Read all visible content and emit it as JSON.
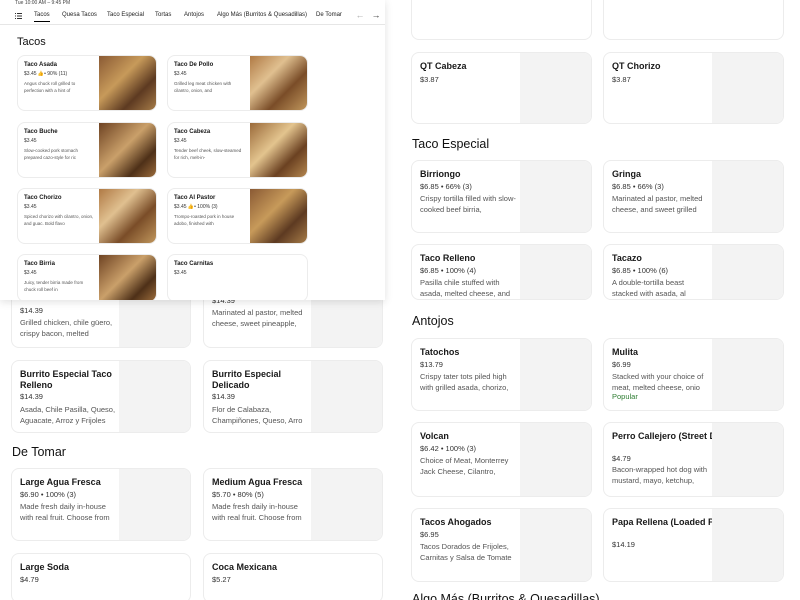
{
  "bg_top": [
    {
      "name": "QT Cabeza",
      "meta": "$3.87"
    },
    {
      "name": "QT Chorizo",
      "meta": "$3.87"
    }
  ],
  "sections": {
    "taco_especial": "Taco Especial",
    "antojos": "Antojos",
    "de_tomar": "De Tomar",
    "algo_mas": "Algo Más (Burritos & Quesadillas)"
  },
  "taco_especial": [
    {
      "name": "Birriongo",
      "meta": "$6.85 • 66% (3)",
      "desc": "Crispy tortilla filled with slow-cooked beef birria,"
    },
    {
      "name": "Gringa",
      "meta": "$6.85 • 66% (3)",
      "desc": "Marinated al pastor, melted cheese, and sweet grilled"
    },
    {
      "name": "Taco Relleno",
      "meta": "$6.85 • 100% (4)",
      "desc": "Pasilla chile stuffed with asada, melted cheese, and"
    },
    {
      "name": "Tacazo",
      "meta": "$6.85 • 100% (6)",
      "desc": "A double-tortilla beast stacked with asada, al"
    }
  ],
  "antojos": [
    {
      "name": "Tatochos",
      "meta": "$13.79",
      "desc": "Crispy tater tots piled high with grilled asada, chorizo,"
    },
    {
      "name": "Mulita",
      "meta": "$6.99",
      "desc": "Stacked with your choice of meat, melted cheese, onio",
      "badge": "Popular"
    },
    {
      "name": "Volcan",
      "meta": "$6.42 • 100% (3)",
      "desc": "Choice of Meat, Monterrey Jack Cheese, Cilantro,"
    },
    {
      "name": "Perro Callejero (Street Dog)",
      "meta": "$4.79",
      "desc": "Bacon-wrapped hot dog with mustard, mayo, ketchup,"
    },
    {
      "name": "Tacos Ahogados",
      "meta": "$6.95",
      "desc": "Tacos Dorados de Frijoles, Carnitas y Salsa de Tomate"
    },
    {
      "name": "Papa Rellena (Loaded Potato)",
      "meta": "$14.19",
      "desc": ""
    }
  ],
  "left_bg": [
    {
      "name": "",
      "meta": "$14.39",
      "desc": "Grilled chicken, chile güero, crispy bacon, melted"
    },
    {
      "name": "",
      "meta": "$14.39",
      "desc": "Marinated al pastor, melted cheese, sweet pineapple,"
    },
    {
      "name": "Burrito Especial Taco Relleno",
      "meta": "$14.39",
      "desc": "Asada, Chile Pasilla, Queso, Aguacate, Arroz y Frijoles"
    },
    {
      "name": "Burrito Especial Delicado",
      "meta": "$14.39",
      "desc": "Flor de Calabaza, Champiñones, Queso, Arro"
    }
  ],
  "de_tomar": [
    {
      "name": "Large Agua Fresca",
      "meta": "$6.90 • 100% (3)",
      "desc": "Made fresh daily in-house with real fruit. Choose from"
    },
    {
      "name": "Medium Agua Fresca",
      "meta": "$5.70 • 80% (5)",
      "desc": "Made fresh daily in-house with real fruit. Choose from"
    },
    {
      "name": "Large Soda",
      "meta": "$4.79",
      "desc": ""
    },
    {
      "name": "Coca Mexicana",
      "meta": "$5.27",
      "desc": ""
    }
  ],
  "panel": {
    "topline": "Tue 10:00 AM – 9:45 PM",
    "tabs": [
      "Tacos",
      "Quesa Tacos",
      "Taco Especial",
      "Tortas",
      "Antojos",
      "Algo Más (Burritos & Quesadillas)",
      "De Tomar"
    ],
    "title": "Tacos",
    "items": [
      {
        "name": "Taco Asada",
        "meta1": "$3.45",
        "meta2": "• 90% (11)",
        "desc": "Angus chuck roll grilled to perfection with a hint of"
      },
      {
        "name": "Taco De Pollo",
        "meta1": "$3.45",
        "meta2": "",
        "desc": "Grilled leg meat chicken with cilantro, onion, and"
      },
      {
        "name": "Taco Buche",
        "meta1": "$3.45",
        "meta2": "",
        "desc": "Slow-cooked pork stomach prepared cazo-style for ric"
      },
      {
        "name": "Taco Cabeza",
        "meta1": "$3.45",
        "meta2": "",
        "desc": "Tender beef cheek, slow-steamed for rich, melt-in-"
      },
      {
        "name": "Taco Chorizo",
        "meta1": "$3.45",
        "meta2": "",
        "desc": "Spiced chorizo with cilantro, onion, and guac. Bold flavo"
      },
      {
        "name": "Taco Al Pastor",
        "meta1": "$3.45",
        "meta2": "• 100% (3)",
        "desc": "Trompo-roasted pork in house adobo, finished with"
      },
      {
        "name": "Taco Birria",
        "meta1": "$3.45",
        "meta2": "",
        "desc": "Juicy, tender birria made from chuck roll beef in"
      },
      {
        "name": "Taco Carnitas",
        "meta1": "$3.45",
        "meta2": "",
        "desc": ""
      }
    ]
  },
  "colors": {
    "accent": "#2e7d32",
    "border": "#ececec"
  }
}
